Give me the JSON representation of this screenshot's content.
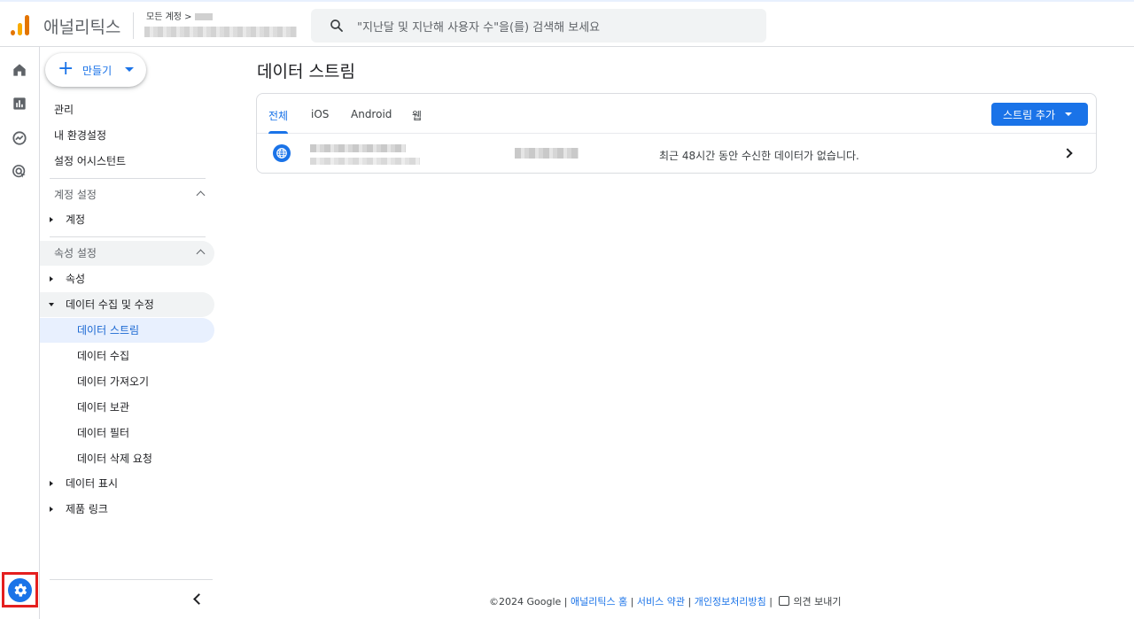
{
  "header": {
    "app_title": "애널리틱스",
    "breadcrumb_label": "모든 계정",
    "breadcrumb_separator": ">",
    "search_placeholder": "\"지난달 및 지난해 사용자 수\"을(를) 검색해 보세요",
    "brand_colors": {
      "logo_orange": "#f9ab00",
      "logo_dark": "#e37400"
    }
  },
  "rail": {
    "icons": [
      "home-icon",
      "reports-icon",
      "explore-icon",
      "advertising-icon"
    ],
    "admin_icon": "gear-icon",
    "highlight_color": "#e41f1f"
  },
  "sidebar": {
    "create_label": "만들기",
    "top_items": [
      "관리",
      "내 환경설정",
      "설정 어시스턴트"
    ],
    "account_section": {
      "title": "계정 설정",
      "items": [
        "계정"
      ]
    },
    "property_section": {
      "title": "속성 설정",
      "property_item": "속성",
      "data_collection": {
        "label": "데이터 수집 및 수정",
        "children": [
          "데이터 스트림",
          "데이터 수집",
          "데이터 가져오기",
          "데이터 보관",
          "데이터 필터",
          "데이터 삭제 요청"
        ]
      },
      "data_display": "데이터 표시",
      "product_links": "제품 링크"
    }
  },
  "main": {
    "title": "데이터 스트림",
    "tabs": [
      "전체",
      "iOS",
      "Android",
      "웹"
    ],
    "active_tab": "전체",
    "add_stream_label": "스트림 추가",
    "stream_row": {
      "type_icon": "globe-icon",
      "status": "최근 48시간 동안 수신한 데이터가 없습니다."
    },
    "accent_color": "#1a73e8"
  },
  "footer": {
    "copyright": "©2024 Google |",
    "links": [
      "애널리틱스 홈",
      "서비스 약관",
      "개인정보처리방침"
    ],
    "separator": "|",
    "feedback": "의견 보내기"
  }
}
